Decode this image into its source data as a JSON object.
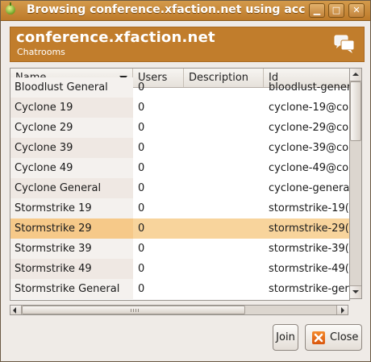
{
  "window": {
    "title": "Browsing conference.xfaction.net using account"
  },
  "header": {
    "title": "conference.xfaction.net",
    "subtitle": "Chatrooms"
  },
  "table": {
    "columns": [
      "Name",
      "Users",
      "Description",
      "Id"
    ],
    "partial_row": {
      "name": "Bloodlust General",
      "users": "0",
      "description": "",
      "id": "bloodlust-gener"
    },
    "rows": [
      {
        "name": "Cyclone 19",
        "users": "0",
        "description": "",
        "id": "cyclone-19@co"
      },
      {
        "name": "Cyclone 29",
        "users": "0",
        "description": "",
        "id": "cyclone-29@co"
      },
      {
        "name": "Cyclone 39",
        "users": "0",
        "description": "",
        "id": "cyclone-39@co"
      },
      {
        "name": "Cyclone 49",
        "users": "0",
        "description": "",
        "id": "cyclone-49@co"
      },
      {
        "name": "Cyclone General",
        "users": "0",
        "description": "",
        "id": "cyclone-genera"
      },
      {
        "name": "Stormstrike 19",
        "users": "0",
        "description": "",
        "id": "stormstrike-19("
      },
      {
        "name": "Stormstrike 29",
        "users": "0",
        "description": "",
        "id": "stormstrike-29("
      },
      {
        "name": "Stormstrike 39",
        "users": "0",
        "description": "",
        "id": "stormstrike-39("
      },
      {
        "name": "Stormstrike 49",
        "users": "0",
        "description": "",
        "id": "stormstrike-49("
      },
      {
        "name": "Stormstrike General",
        "users": "0",
        "description": "",
        "id": "stormstrike-ger"
      }
    ],
    "selected_index": 6
  },
  "buttons": {
    "join_label": "Join",
    "close_label": "Close"
  },
  "icons": {
    "app": "pidgin-icon",
    "header": "chat-bubbles-icon",
    "close": "close-x-icon"
  }
}
